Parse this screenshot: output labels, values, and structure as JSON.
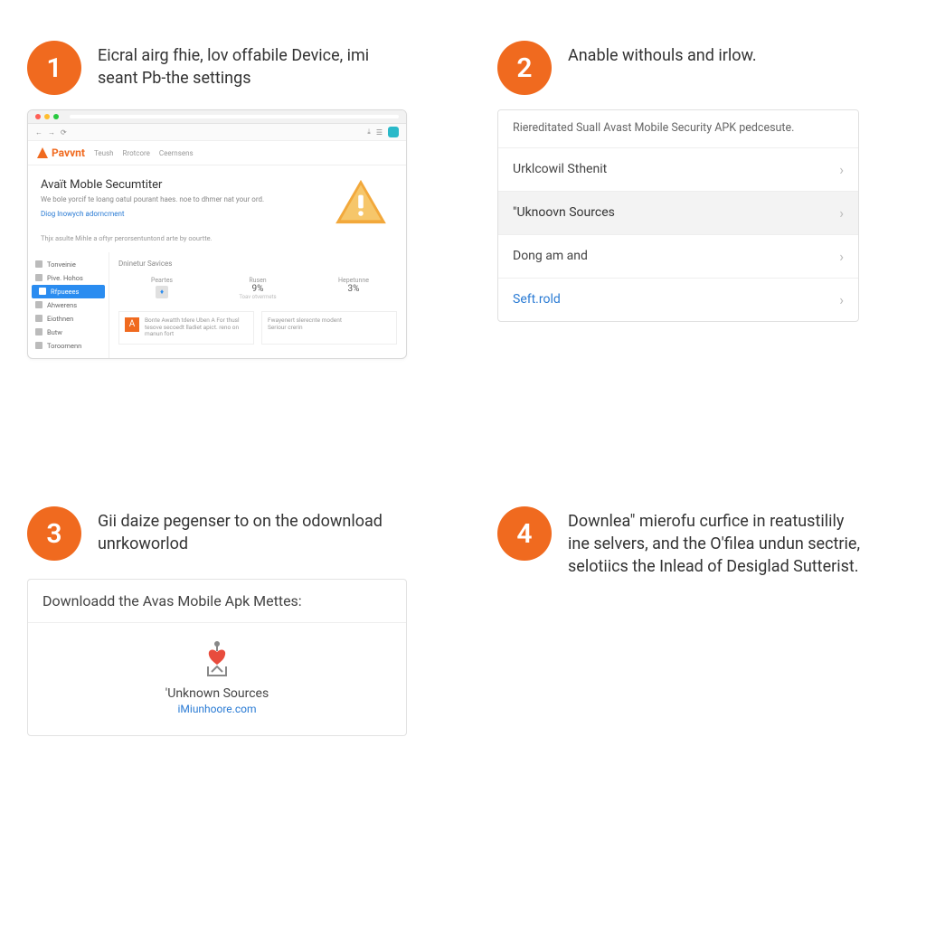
{
  "steps": {
    "s1": {
      "num": "1",
      "text": "Eicral airg fhie, lov offabile Device, imi seant Pb-the settings"
    },
    "s2": {
      "num": "2",
      "text": "Anable withouls and irlow."
    },
    "s3": {
      "num": "3",
      "text": "Gii daize pegenser to on the odownload unrkoworlod"
    },
    "s4": {
      "num": "4",
      "text": "Downlea\" mierofu curfice in reatustilily ine selvers, and the O'filea undun sectrie, selotiics the Inlead of Desiglad Sutterist."
    }
  },
  "browser": {
    "tab": " ",
    "url": " ",
    "brand": "Pavvnt",
    "nav": [
      "Teush",
      "Rrotcore",
      "Ceernsens"
    ],
    "hero_title": "Avaït Moble Secumtiter",
    "hero_sub1": "We bole yorcif te loang oatul pourant haes. noe to dhmer nat your ord.",
    "hero_link": "Diog lnowych adorncment",
    "hero_foot": "Thjx asulte Mihle a oftyr perorsentuntond arte by oourtte.",
    "sidebar": [
      {
        "label": "Tonveinie"
      },
      {
        "label": "Pive. Hohos"
      },
      {
        "label": "Rfpueees",
        "active": true
      },
      {
        "label": "Ahwerens"
      },
      {
        "label": "Eiothnen"
      },
      {
        "label": "Butw"
      },
      {
        "label": "Toroomenn"
      }
    ],
    "section_title": "Dninetur Savices",
    "stats": [
      {
        "lbl": "Peartes",
        "val": "",
        "sub": ""
      },
      {
        "lbl": "Rusen",
        "val": "9%",
        "sub": "Toav otvermets"
      },
      {
        "lbl": "Hepetunne",
        "val": "3%",
        "sub": ""
      }
    ],
    "card1_title": "Bonte Awatth tdere Uben A For thusl",
    "card1_sub": "tesove secoedt lladiet apict. reno on manun fort",
    "card2_title": "Fwayenert slerecnte modent",
    "card2_sub": "Seriour crerin"
  },
  "settings": {
    "head": "Riereditated Suall Avast Mobile Security APK pedcesute.",
    "rows": [
      {
        "label": "Urklcowil Sthenit",
        "type": "normal"
      },
      {
        "label": "\"Uknoovn Sources",
        "type": "hl"
      },
      {
        "label": "Dong am and",
        "type": "normal"
      },
      {
        "label": "Seft.rold",
        "type": "link"
      }
    ]
  },
  "download": {
    "head": "Downloadd the Avas Mobile Apk Mettes:",
    "label": "'Unknown Sources",
    "link": "iMiunhoore.com"
  }
}
